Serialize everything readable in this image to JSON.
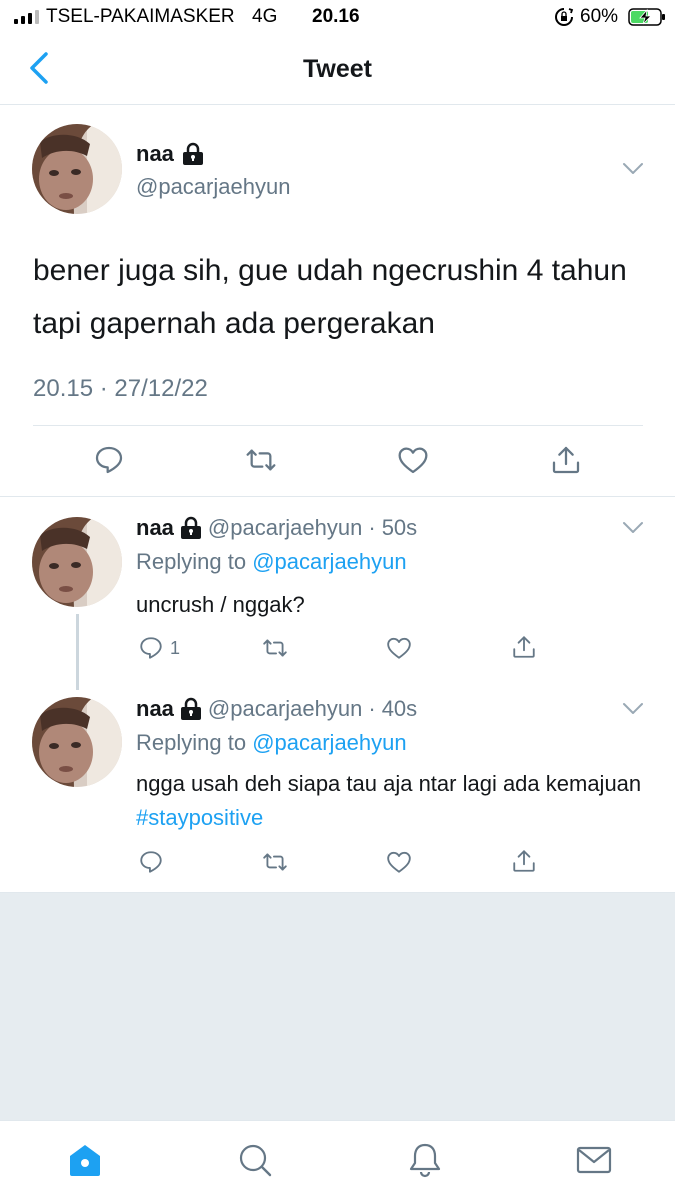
{
  "status_bar": {
    "carrier": "TSEL-PAKAIMASKER",
    "network": "4G",
    "time": "20.16",
    "battery": "60%"
  },
  "header": {
    "title": "Tweet",
    "back_icon": "chevron-left-icon"
  },
  "colors": {
    "accent": "#1da1f2",
    "secondary_text": "#657786",
    "border": "#e1e8ed",
    "background_grey": "#e6ecf0"
  },
  "main_tweet": {
    "name": "naa",
    "handle": "@pacarjaehyun",
    "text": "bener juga sih, gue udah ngecrushin 4 tahun tapi gapernah ada pergerakan",
    "timestamp": "20.15 · 27/12/22"
  },
  "replies": [
    {
      "name": "naa",
      "handle": "@pacarjaehyun",
      "dot": "·",
      "ago": "50s",
      "replying_prefix": "Replying to ",
      "replying_to": "@pacarjaehyun",
      "text": "uncrush / nggak?",
      "reply_count": "1"
    },
    {
      "name": "naa",
      "handle": "@pacarjaehyun",
      "dot": "·",
      "ago": "40s",
      "replying_prefix": "Replying to ",
      "replying_to": "@pacarjaehyun",
      "text": "ngga usah deh siapa tau aja ntar lagi ada kemajuan ",
      "hashtag": "#staypositive"
    }
  ],
  "tabs": [
    {
      "icon": "home-icon",
      "active": true
    },
    {
      "icon": "search-icon",
      "active": false
    },
    {
      "icon": "notifications-bell-icon",
      "active": false
    },
    {
      "icon": "messages-envelope-icon",
      "active": false
    }
  ]
}
